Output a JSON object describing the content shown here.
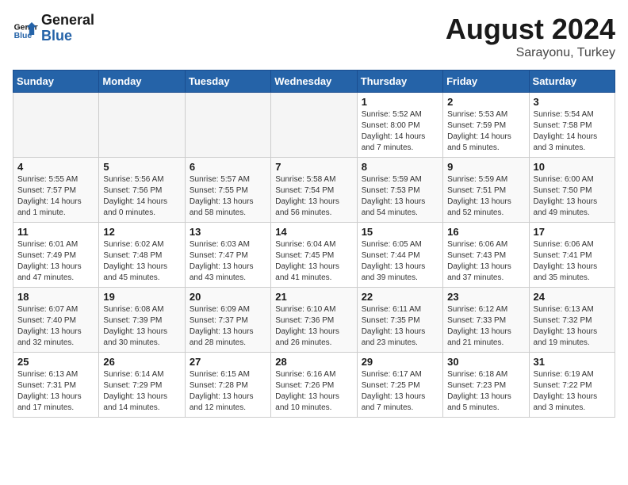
{
  "logo": {
    "text_general": "General",
    "text_blue": "Blue"
  },
  "header": {
    "month": "August 2024",
    "location": "Sarayonu, Turkey"
  },
  "weekdays": [
    "Sunday",
    "Monday",
    "Tuesday",
    "Wednesday",
    "Thursday",
    "Friday",
    "Saturday"
  ],
  "weeks": [
    [
      {
        "day": "",
        "empty": true
      },
      {
        "day": "",
        "empty": true
      },
      {
        "day": "",
        "empty": true
      },
      {
        "day": "",
        "empty": true
      },
      {
        "day": "1",
        "sunrise": "5:52 AM",
        "sunset": "8:00 PM",
        "daylight": "14 hours and 7 minutes."
      },
      {
        "day": "2",
        "sunrise": "5:53 AM",
        "sunset": "7:59 PM",
        "daylight": "14 hours and 5 minutes."
      },
      {
        "day": "3",
        "sunrise": "5:54 AM",
        "sunset": "7:58 PM",
        "daylight": "14 hours and 3 minutes."
      }
    ],
    [
      {
        "day": "4",
        "sunrise": "5:55 AM",
        "sunset": "7:57 PM",
        "daylight": "14 hours and 1 minute."
      },
      {
        "day": "5",
        "sunrise": "5:56 AM",
        "sunset": "7:56 PM",
        "daylight": "14 hours and 0 minutes."
      },
      {
        "day": "6",
        "sunrise": "5:57 AM",
        "sunset": "7:55 PM",
        "daylight": "13 hours and 58 minutes."
      },
      {
        "day": "7",
        "sunrise": "5:58 AM",
        "sunset": "7:54 PM",
        "daylight": "13 hours and 56 minutes."
      },
      {
        "day": "8",
        "sunrise": "5:59 AM",
        "sunset": "7:53 PM",
        "daylight": "13 hours and 54 minutes."
      },
      {
        "day": "9",
        "sunrise": "5:59 AM",
        "sunset": "7:51 PM",
        "daylight": "13 hours and 52 minutes."
      },
      {
        "day": "10",
        "sunrise": "6:00 AM",
        "sunset": "7:50 PM",
        "daylight": "13 hours and 49 minutes."
      }
    ],
    [
      {
        "day": "11",
        "sunrise": "6:01 AM",
        "sunset": "7:49 PM",
        "daylight": "13 hours and 47 minutes."
      },
      {
        "day": "12",
        "sunrise": "6:02 AM",
        "sunset": "7:48 PM",
        "daylight": "13 hours and 45 minutes."
      },
      {
        "day": "13",
        "sunrise": "6:03 AM",
        "sunset": "7:47 PM",
        "daylight": "13 hours and 43 minutes."
      },
      {
        "day": "14",
        "sunrise": "6:04 AM",
        "sunset": "7:45 PM",
        "daylight": "13 hours and 41 minutes."
      },
      {
        "day": "15",
        "sunrise": "6:05 AM",
        "sunset": "7:44 PM",
        "daylight": "13 hours and 39 minutes."
      },
      {
        "day": "16",
        "sunrise": "6:06 AM",
        "sunset": "7:43 PM",
        "daylight": "13 hours and 37 minutes."
      },
      {
        "day": "17",
        "sunrise": "6:06 AM",
        "sunset": "7:41 PM",
        "daylight": "13 hours and 35 minutes."
      }
    ],
    [
      {
        "day": "18",
        "sunrise": "6:07 AM",
        "sunset": "7:40 PM",
        "daylight": "13 hours and 32 minutes."
      },
      {
        "day": "19",
        "sunrise": "6:08 AM",
        "sunset": "7:39 PM",
        "daylight": "13 hours and 30 minutes."
      },
      {
        "day": "20",
        "sunrise": "6:09 AM",
        "sunset": "7:37 PM",
        "daylight": "13 hours and 28 minutes."
      },
      {
        "day": "21",
        "sunrise": "6:10 AM",
        "sunset": "7:36 PM",
        "daylight": "13 hours and 26 minutes."
      },
      {
        "day": "22",
        "sunrise": "6:11 AM",
        "sunset": "7:35 PM",
        "daylight": "13 hours and 23 minutes."
      },
      {
        "day": "23",
        "sunrise": "6:12 AM",
        "sunset": "7:33 PM",
        "daylight": "13 hours and 21 minutes."
      },
      {
        "day": "24",
        "sunrise": "6:13 AM",
        "sunset": "7:32 PM",
        "daylight": "13 hours and 19 minutes."
      }
    ],
    [
      {
        "day": "25",
        "sunrise": "6:13 AM",
        "sunset": "7:31 PM",
        "daylight": "13 hours and 17 minutes."
      },
      {
        "day": "26",
        "sunrise": "6:14 AM",
        "sunset": "7:29 PM",
        "daylight": "13 hours and 14 minutes."
      },
      {
        "day": "27",
        "sunrise": "6:15 AM",
        "sunset": "7:28 PM",
        "daylight": "13 hours and 12 minutes."
      },
      {
        "day": "28",
        "sunrise": "6:16 AM",
        "sunset": "7:26 PM",
        "daylight": "13 hours and 10 minutes."
      },
      {
        "day": "29",
        "sunrise": "6:17 AM",
        "sunset": "7:25 PM",
        "daylight": "13 hours and 7 minutes."
      },
      {
        "day": "30",
        "sunrise": "6:18 AM",
        "sunset": "7:23 PM",
        "daylight": "13 hours and 5 minutes."
      },
      {
        "day": "31",
        "sunrise": "6:19 AM",
        "sunset": "7:22 PM",
        "daylight": "13 hours and 3 minutes."
      }
    ]
  ]
}
